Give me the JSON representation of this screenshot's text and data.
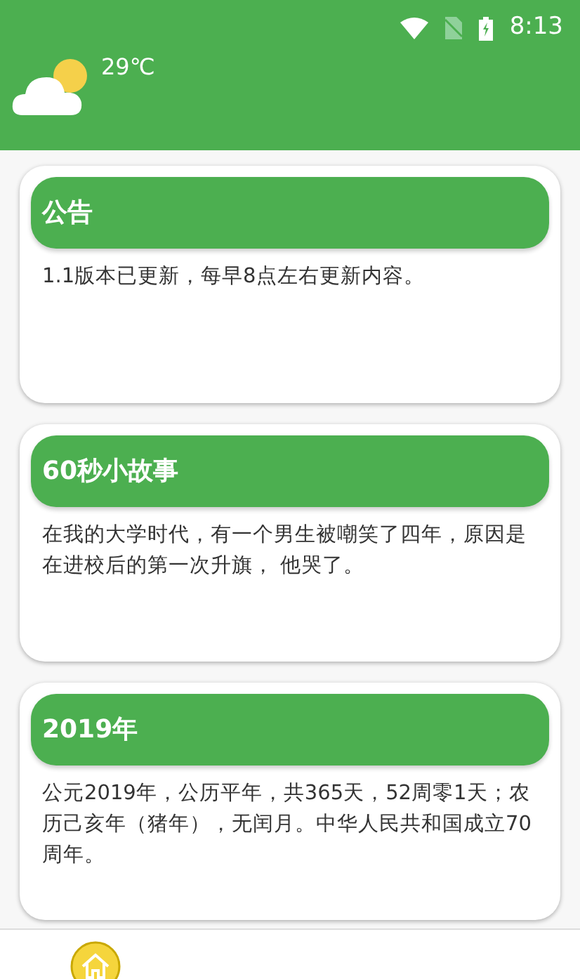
{
  "status_bar": {
    "time": "8:13"
  },
  "weather": {
    "temperature": "29℃"
  },
  "cards": [
    {
      "title": "公告",
      "body": "1.1版本已更新，每早8点左右更新内容。"
    },
    {
      "title": "60秒小故事",
      "body": "在我的大学时代，有一个男生被嘲笑了四年，原因是在进校后的第一次升旗， 他哭了。"
    },
    {
      "title": "2019年",
      "body": "公元2019年，公历平年，共365天，52周零1天；农历己亥年（猪年），无闰月。中华人民共和国成立70周年。"
    }
  ],
  "bottom_nav": [
    {
      "kind": "home",
      "selected": true
    }
  ]
}
